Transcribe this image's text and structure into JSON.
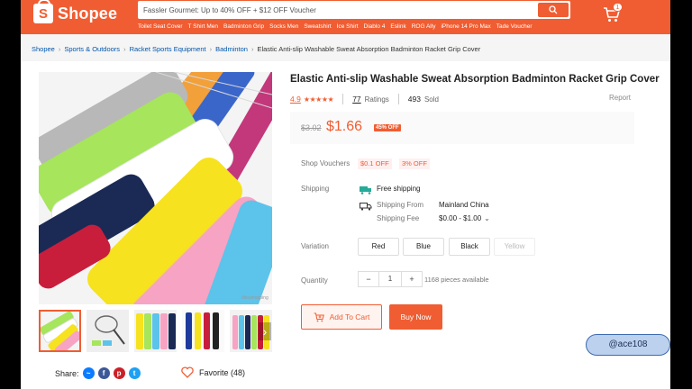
{
  "header": {
    "logo_text": "Shopee",
    "search_value": "Fassler Gourmet: Up to 40% OFF + $12 OFF Voucher",
    "search_links": [
      "Toilet Seat Cover",
      "T Shirt Men",
      "Badminton Grip",
      "Socks Men",
      "Sweatshirt",
      "Ice Shirt",
      "Diablo 4",
      "Eslink",
      "ROG Ally",
      "iPhone 14 Pro Max",
      "Tade Voucher"
    ],
    "cart_count": "1",
    "brand_color": "#f05d32"
  },
  "breadcrumb": {
    "items": [
      "Shopee",
      "Sports & Outdoors",
      "Racket Sports Equipment",
      "Badminton"
    ],
    "current": "Elastic Anti-slip Washable Sweat Absorption Badminton Racket Grip Cover"
  },
  "product": {
    "title": "Elastic Anti-slip Washable Sweat Absorption Badminton Racket Grip Cover",
    "rating": "4.9",
    "stars": "★★★★★",
    "ratings_count": "77",
    "ratings_label": "Ratings",
    "sold_count": "493",
    "sold_label": "Sold",
    "report_label": "Report",
    "old_price": "$3.02",
    "price": "$1.66",
    "discount": "45% OFF"
  },
  "vouchers": {
    "label": "Shop Vouchers",
    "items": [
      "$0.1 OFF",
      "3% OFF"
    ]
  },
  "shipping": {
    "label": "Shipping",
    "free": "Free shipping",
    "from_label": "Shipping From",
    "from_value": "Mainland China",
    "fee_label": "Shipping Fee",
    "fee_value": "$0.00 - $1.00"
  },
  "variation": {
    "label": "Variation",
    "options": [
      "Red",
      "Blue",
      "Black",
      "Yellow"
    ]
  },
  "quantity": {
    "label": "Quantity",
    "value": "1",
    "minus": "−",
    "plus": "+",
    "available": "1168 pieces available"
  },
  "actions": {
    "add_to_cart": "Add To Cart",
    "buy_now": "Buy Now"
  },
  "social": {
    "share_label": "Share:",
    "favorite_label": "Favorite (48)"
  },
  "gallery": {
    "image_caption": "ditsumopping",
    "next": "›"
  },
  "overlay": {
    "watermark": "@ace108"
  }
}
